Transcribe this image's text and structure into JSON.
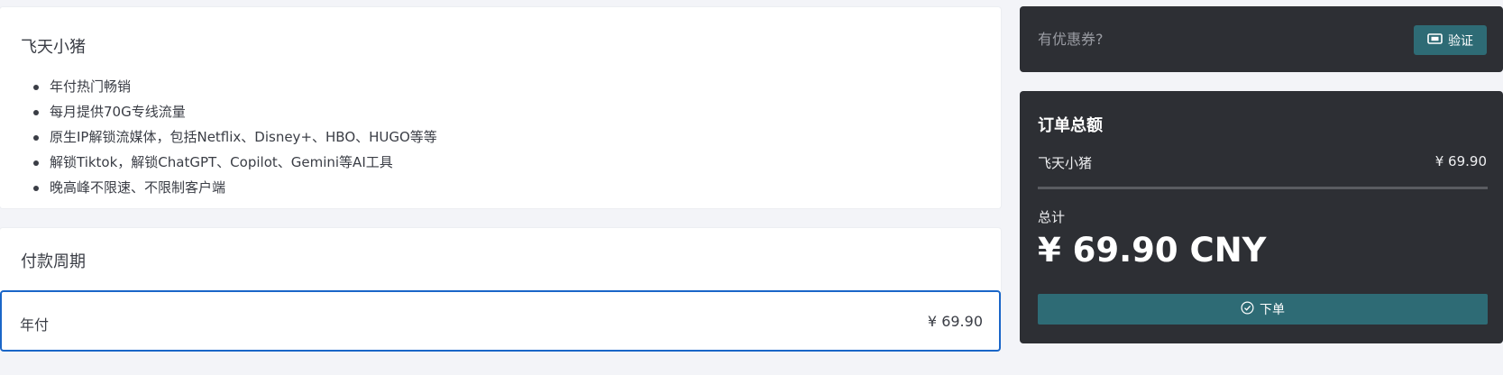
{
  "plan": {
    "title": "飞天小猪",
    "features": [
      "年付热门畅销",
      "每月提供70G专线流量",
      "原生IP解锁流媒体，包括Netflix、Disney+、HBO、HUGO等等",
      "解锁Tiktok，解锁ChatGPT、Copilot、Gemini等AI工具",
      "晚高峰不限速、不限制客户端"
    ]
  },
  "period": {
    "title": "付款周期",
    "selected_label": "年付",
    "selected_price": "¥ 69.90"
  },
  "coupon": {
    "placeholder": "有优惠券?",
    "verify_label": "验证",
    "verify_icon": "ticket-icon"
  },
  "summary": {
    "title": "订单总额",
    "item_name": "飞天小猪",
    "item_price": "¥ 69.90",
    "total_label": "总计",
    "total_amount": "¥ 69.90 CNY",
    "order_label": "下单",
    "order_icon": "check-circle-icon"
  },
  "colors": {
    "accent_teal": "#2e6b75",
    "selected_border": "#1a66c8",
    "dark_panel": "#2d2f34"
  }
}
